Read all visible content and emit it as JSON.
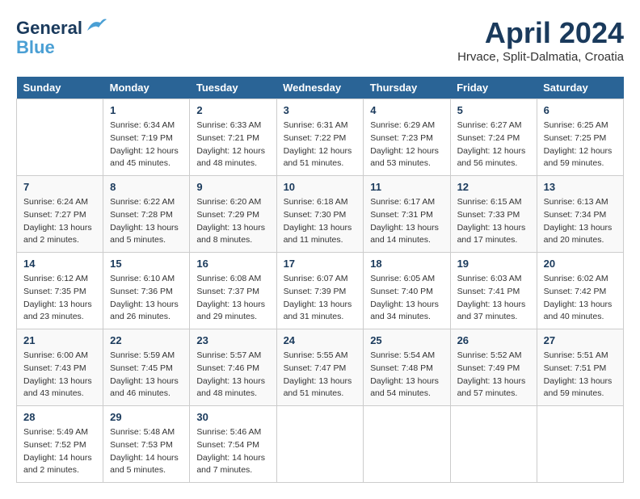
{
  "header": {
    "logo_line1": "General",
    "logo_line2": "Blue",
    "month_title": "April 2024",
    "subtitle": "Hrvace, Split-Dalmatia, Croatia"
  },
  "days_of_week": [
    "Sunday",
    "Monday",
    "Tuesday",
    "Wednesday",
    "Thursday",
    "Friday",
    "Saturday"
  ],
  "weeks": [
    [
      {
        "day": "",
        "sunrise": "",
        "sunset": "",
        "daylight": ""
      },
      {
        "day": "1",
        "sunrise": "Sunrise: 6:34 AM",
        "sunset": "Sunset: 7:19 PM",
        "daylight": "Daylight: 12 hours and 45 minutes."
      },
      {
        "day": "2",
        "sunrise": "Sunrise: 6:33 AM",
        "sunset": "Sunset: 7:21 PM",
        "daylight": "Daylight: 12 hours and 48 minutes."
      },
      {
        "day": "3",
        "sunrise": "Sunrise: 6:31 AM",
        "sunset": "Sunset: 7:22 PM",
        "daylight": "Daylight: 12 hours and 51 minutes."
      },
      {
        "day": "4",
        "sunrise": "Sunrise: 6:29 AM",
        "sunset": "Sunset: 7:23 PM",
        "daylight": "Daylight: 12 hours and 53 minutes."
      },
      {
        "day": "5",
        "sunrise": "Sunrise: 6:27 AM",
        "sunset": "Sunset: 7:24 PM",
        "daylight": "Daylight: 12 hours and 56 minutes."
      },
      {
        "day": "6",
        "sunrise": "Sunrise: 6:25 AM",
        "sunset": "Sunset: 7:25 PM",
        "daylight": "Daylight: 12 hours and 59 minutes."
      }
    ],
    [
      {
        "day": "7",
        "sunrise": "Sunrise: 6:24 AM",
        "sunset": "Sunset: 7:27 PM",
        "daylight": "Daylight: 13 hours and 2 minutes."
      },
      {
        "day": "8",
        "sunrise": "Sunrise: 6:22 AM",
        "sunset": "Sunset: 7:28 PM",
        "daylight": "Daylight: 13 hours and 5 minutes."
      },
      {
        "day": "9",
        "sunrise": "Sunrise: 6:20 AM",
        "sunset": "Sunset: 7:29 PM",
        "daylight": "Daylight: 13 hours and 8 minutes."
      },
      {
        "day": "10",
        "sunrise": "Sunrise: 6:18 AM",
        "sunset": "Sunset: 7:30 PM",
        "daylight": "Daylight: 13 hours and 11 minutes."
      },
      {
        "day": "11",
        "sunrise": "Sunrise: 6:17 AM",
        "sunset": "Sunset: 7:31 PM",
        "daylight": "Daylight: 13 hours and 14 minutes."
      },
      {
        "day": "12",
        "sunrise": "Sunrise: 6:15 AM",
        "sunset": "Sunset: 7:33 PM",
        "daylight": "Daylight: 13 hours and 17 minutes."
      },
      {
        "day": "13",
        "sunrise": "Sunrise: 6:13 AM",
        "sunset": "Sunset: 7:34 PM",
        "daylight": "Daylight: 13 hours and 20 minutes."
      }
    ],
    [
      {
        "day": "14",
        "sunrise": "Sunrise: 6:12 AM",
        "sunset": "Sunset: 7:35 PM",
        "daylight": "Daylight: 13 hours and 23 minutes."
      },
      {
        "day": "15",
        "sunrise": "Sunrise: 6:10 AM",
        "sunset": "Sunset: 7:36 PM",
        "daylight": "Daylight: 13 hours and 26 minutes."
      },
      {
        "day": "16",
        "sunrise": "Sunrise: 6:08 AM",
        "sunset": "Sunset: 7:37 PM",
        "daylight": "Daylight: 13 hours and 29 minutes."
      },
      {
        "day": "17",
        "sunrise": "Sunrise: 6:07 AM",
        "sunset": "Sunset: 7:39 PM",
        "daylight": "Daylight: 13 hours and 31 minutes."
      },
      {
        "day": "18",
        "sunrise": "Sunrise: 6:05 AM",
        "sunset": "Sunset: 7:40 PM",
        "daylight": "Daylight: 13 hours and 34 minutes."
      },
      {
        "day": "19",
        "sunrise": "Sunrise: 6:03 AM",
        "sunset": "Sunset: 7:41 PM",
        "daylight": "Daylight: 13 hours and 37 minutes."
      },
      {
        "day": "20",
        "sunrise": "Sunrise: 6:02 AM",
        "sunset": "Sunset: 7:42 PM",
        "daylight": "Daylight: 13 hours and 40 minutes."
      }
    ],
    [
      {
        "day": "21",
        "sunrise": "Sunrise: 6:00 AM",
        "sunset": "Sunset: 7:43 PM",
        "daylight": "Daylight: 13 hours and 43 minutes."
      },
      {
        "day": "22",
        "sunrise": "Sunrise: 5:59 AM",
        "sunset": "Sunset: 7:45 PM",
        "daylight": "Daylight: 13 hours and 46 minutes."
      },
      {
        "day": "23",
        "sunrise": "Sunrise: 5:57 AM",
        "sunset": "Sunset: 7:46 PM",
        "daylight": "Daylight: 13 hours and 48 minutes."
      },
      {
        "day": "24",
        "sunrise": "Sunrise: 5:55 AM",
        "sunset": "Sunset: 7:47 PM",
        "daylight": "Daylight: 13 hours and 51 minutes."
      },
      {
        "day": "25",
        "sunrise": "Sunrise: 5:54 AM",
        "sunset": "Sunset: 7:48 PM",
        "daylight": "Daylight: 13 hours and 54 minutes."
      },
      {
        "day": "26",
        "sunrise": "Sunrise: 5:52 AM",
        "sunset": "Sunset: 7:49 PM",
        "daylight": "Daylight: 13 hours and 57 minutes."
      },
      {
        "day": "27",
        "sunrise": "Sunrise: 5:51 AM",
        "sunset": "Sunset: 7:51 PM",
        "daylight": "Daylight: 13 hours and 59 minutes."
      }
    ],
    [
      {
        "day": "28",
        "sunrise": "Sunrise: 5:49 AM",
        "sunset": "Sunset: 7:52 PM",
        "daylight": "Daylight: 14 hours and 2 minutes."
      },
      {
        "day": "29",
        "sunrise": "Sunrise: 5:48 AM",
        "sunset": "Sunset: 7:53 PM",
        "daylight": "Daylight: 14 hours and 5 minutes."
      },
      {
        "day": "30",
        "sunrise": "Sunrise: 5:46 AM",
        "sunset": "Sunset: 7:54 PM",
        "daylight": "Daylight: 14 hours and 7 minutes."
      },
      {
        "day": "",
        "sunrise": "",
        "sunset": "",
        "daylight": ""
      },
      {
        "day": "",
        "sunrise": "",
        "sunset": "",
        "daylight": ""
      },
      {
        "day": "",
        "sunrise": "",
        "sunset": "",
        "daylight": ""
      },
      {
        "day": "",
        "sunrise": "",
        "sunset": "",
        "daylight": ""
      }
    ]
  ]
}
